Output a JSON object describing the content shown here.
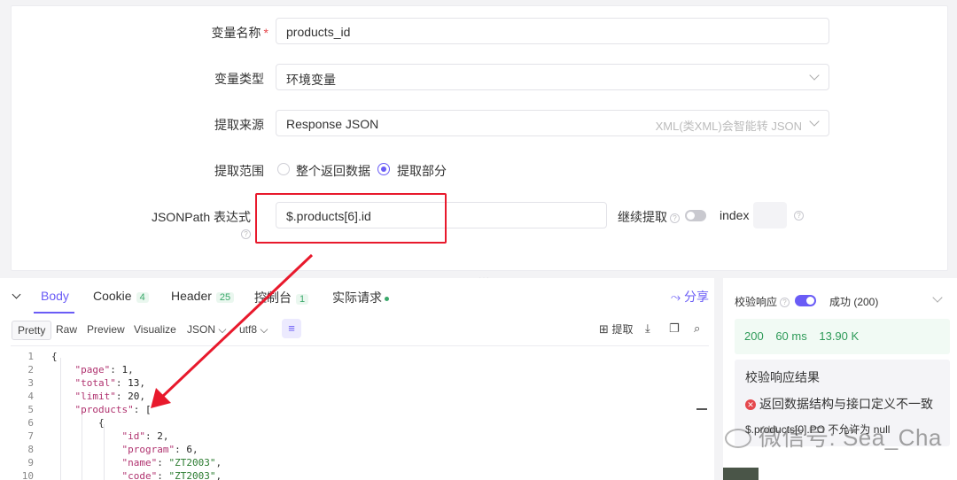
{
  "form": {
    "var_name_label": "变量名称",
    "required_mark": "*",
    "var_name_value": "products_id",
    "var_type_label": "变量类型",
    "var_type_value": "环境变量",
    "source_label": "提取来源",
    "source_value": "Response JSON",
    "source_hint": "XML(类XML)会智能转 JSON",
    "scope_label": "提取范围",
    "scope_options": [
      "整个返回数据",
      "提取部分"
    ],
    "scope_selected": "提取部分",
    "jsonpath_label": "JSONPath 表达式",
    "jsonpath_value": "$.products[6].id",
    "continue_label": "继续提取",
    "index_label": "index",
    "index_value": ""
  },
  "response": {
    "tabs": [
      {
        "label": "Body",
        "count": ""
      },
      {
        "label": "Cookie",
        "count": "4"
      },
      {
        "label": "Header",
        "count": "25"
      },
      {
        "label": "控制台",
        "count": "1"
      },
      {
        "label": "实际请求",
        "count": ""
      }
    ],
    "active_tab": "Body",
    "share_label": "分享",
    "view_modes": [
      "Pretty",
      "Raw",
      "Preview",
      "Visualize"
    ],
    "selected_view": "Pretty",
    "format_value": "JSON",
    "encoding_value": "utf8",
    "extract_label": "提取",
    "code_lines": [
      {
        "n": "1",
        "text": "{"
      },
      {
        "n": "2",
        "k": "\"page\"",
        "v": "1",
        "t": "num"
      },
      {
        "n": "3",
        "k": "\"total\"",
        "v": "13",
        "t": "num"
      },
      {
        "n": "4",
        "k": "\"limit\"",
        "v": "20",
        "t": "num"
      },
      {
        "n": "5",
        "k": "\"products\"",
        "v": "[",
        "t": "punct"
      },
      {
        "n": "6",
        "text": "{"
      },
      {
        "n": "7",
        "k": "\"id\"",
        "v": "2",
        "t": "num"
      },
      {
        "n": "8",
        "k": "\"program\"",
        "v": "6",
        "t": "num"
      },
      {
        "n": "9",
        "k": "\"name\"",
        "v": "\"ZT2003\"",
        "t": "str"
      },
      {
        "n": "10",
        "k": "\"code\"",
        "v": "\"ZT2003\"",
        "t": "str"
      }
    ]
  },
  "validation": {
    "title": "校验响应",
    "status": "成功 (200)",
    "status_code": "200",
    "time": "60 ms",
    "size": "13.90 K",
    "result_title": "校验响应结果",
    "errors": [
      "返回数据结构与接口定义不一致",
      "$.products[0].PO 不允许为 null"
    ]
  },
  "watermark": "微信号: Sea_Cha",
  "colors": {
    "accent": "#6a5cf6",
    "success": "#2e9a58",
    "error": "#e5484d",
    "annotation": "#e8192c"
  }
}
